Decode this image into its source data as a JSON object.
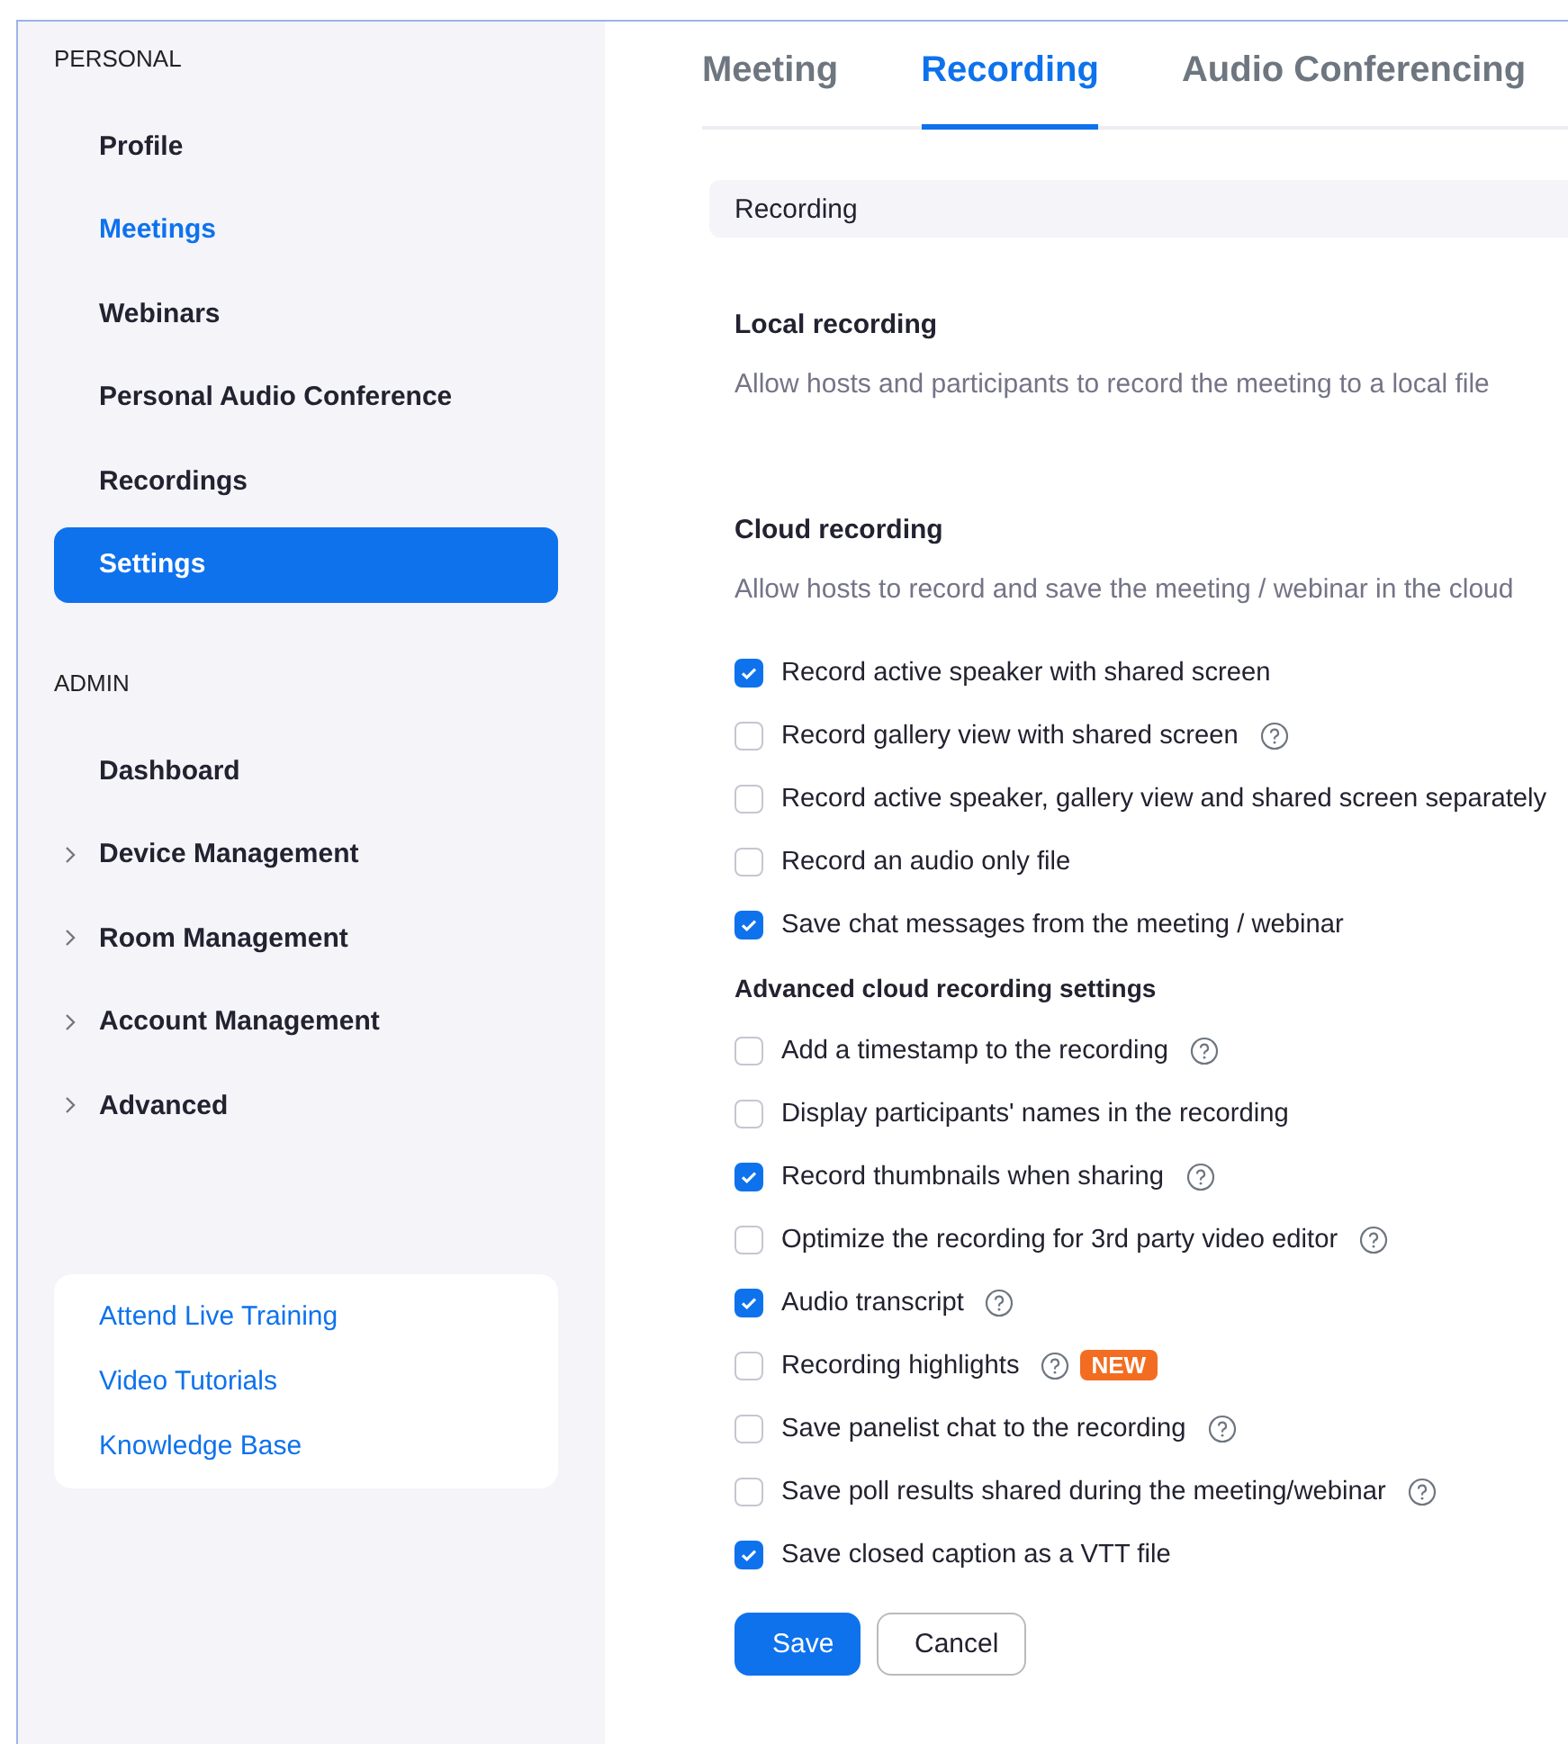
{
  "sidebar": {
    "sections": [
      {
        "heading": "PERSONAL",
        "items": [
          {
            "label": "Profile",
            "kind": "link",
            "selected": false,
            "highlighted": false
          },
          {
            "label": "Meetings",
            "kind": "link",
            "selected": false,
            "highlighted": true
          },
          {
            "label": "Webinars",
            "kind": "link",
            "selected": false,
            "highlighted": false
          },
          {
            "label": "Personal Audio Conference",
            "kind": "link",
            "selected": false,
            "highlighted": false
          },
          {
            "label": "Recordings",
            "kind": "link",
            "selected": false,
            "highlighted": false
          },
          {
            "label": "Settings",
            "kind": "link",
            "selected": true,
            "highlighted": false
          }
        ]
      },
      {
        "heading": "ADMIN",
        "items": [
          {
            "label": "Dashboard",
            "kind": "link",
            "selected": false,
            "highlighted": false
          },
          {
            "label": "Device Management",
            "kind": "group",
            "selected": false,
            "highlighted": false
          },
          {
            "label": "Room Management",
            "kind": "group",
            "selected": false,
            "highlighted": false
          },
          {
            "label": "Account Management",
            "kind": "group",
            "selected": false,
            "highlighted": false
          },
          {
            "label": "Advanced",
            "kind": "group",
            "selected": false,
            "highlighted": false
          }
        ]
      }
    ],
    "help_links": [
      "Attend Live Training",
      "Video Tutorials",
      "Knowledge Base"
    ]
  },
  "tabs": [
    {
      "label": "Meeting",
      "selected": false
    },
    {
      "label": "Recording",
      "selected": true
    },
    {
      "label": "Audio Conferencing",
      "selected": false
    }
  ],
  "section_header": "Recording",
  "settings": [
    {
      "kind": "heading",
      "title": "Local recording",
      "description": "Allow hosts and participants to record the meeting to a local file"
    },
    {
      "kind": "heading",
      "title": "Cloud recording",
      "description": "Allow hosts to record and save the meeting / webinar in the cloud"
    },
    {
      "kind": "checkbox",
      "label": "Record active speaker with shared screen",
      "checked": true,
      "help": false
    },
    {
      "kind": "checkbox",
      "label": "Record gallery view with shared screen",
      "checked": false,
      "help": true
    },
    {
      "kind": "checkbox",
      "label": "Record active speaker, gallery view and shared screen separately",
      "checked": false,
      "help": false
    },
    {
      "kind": "checkbox",
      "label": "Record an audio only file",
      "checked": false,
      "help": false
    },
    {
      "kind": "checkbox",
      "label": "Save chat messages from the meeting / webinar",
      "checked": true,
      "help": false
    },
    {
      "kind": "subheading",
      "title": "Advanced cloud recording settings"
    },
    {
      "kind": "checkbox",
      "label": "Add a timestamp to the recording",
      "checked": false,
      "help": true
    },
    {
      "kind": "checkbox",
      "label": "Display participants' names in the recording",
      "checked": false,
      "help": false
    },
    {
      "kind": "checkbox",
      "label": "Record thumbnails when sharing",
      "checked": true,
      "help": true
    },
    {
      "kind": "checkbox",
      "label": "Optimize the recording for 3rd party video editor",
      "checked": false,
      "help": true
    },
    {
      "kind": "checkbox",
      "label": "Audio transcript",
      "checked": true,
      "help": true
    },
    {
      "kind": "checkbox",
      "label": "Recording highlights",
      "checked": false,
      "help": true,
      "badge": "NEW"
    },
    {
      "kind": "checkbox",
      "label": "Save panelist chat to the recording",
      "checked": false,
      "help": true
    },
    {
      "kind": "checkbox",
      "label": "Save poll results shared during the meeting/webinar",
      "checked": false,
      "help": true
    },
    {
      "kind": "checkbox",
      "label": "Save closed caption as a VTT file",
      "checked": true,
      "help": false
    }
  ],
  "buttons": [
    {
      "label": "Save",
      "kind": "primary"
    },
    {
      "label": "Cancel",
      "kind": "secondary"
    }
  ]
}
